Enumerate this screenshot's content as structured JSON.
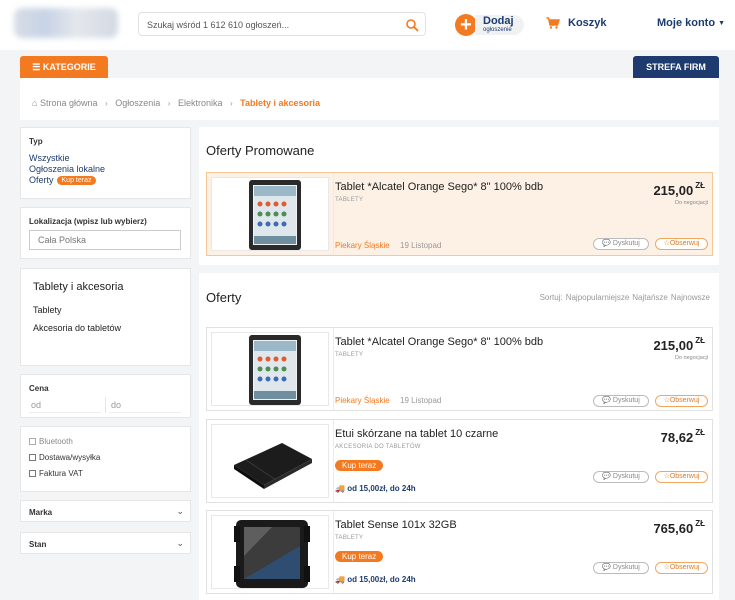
{
  "header": {
    "search_placeholder": "Szukaj wśród 1 612 610 ogłoszeń...",
    "add_main": "Dodaj",
    "add_sub": "ogłoszenie",
    "cart": "Koszyk",
    "account": "Moje konto"
  },
  "tabs": {
    "kategorie": "KATEGORIE",
    "strefa": "STREFA FIRM"
  },
  "breadcrumb": [
    "Strona główna",
    "Ogłoszenia",
    "Elektronika",
    "Tablety i akcesoria"
  ],
  "sidebar": {
    "typ_title": "Typ",
    "typ_links": [
      "Wszystkie",
      "Ogłoszenia lokalne",
      "Oferty"
    ],
    "buy_badge": "Kup teraz",
    "location_label": "Lokalizacja (wpisz lub wybierz)",
    "location_placeholder": "Cała Polska",
    "category_title": "Tablety i akcesoria",
    "category_items": [
      "Tablety",
      "Akcesoria do tabletów"
    ],
    "price_label": "Cena",
    "price_from": "od",
    "price_to": "do",
    "checkboxes": [
      "Bluetooth",
      "Dostawa/wysyłka",
      "Faktura VAT"
    ],
    "dropdowns": [
      "Marka",
      "Stan"
    ]
  },
  "promoted": {
    "title": "Oferty Promowane",
    "listing": {
      "title": "Tablet *Alcatel Orange Sego* 8\" 100% bdb",
      "category": "TABLETY",
      "price": "215,00",
      "currency": "ZŁ",
      "negotiable": "Do negocjacji",
      "location": "Piekary Śląskie",
      "date": "19 Listopad"
    }
  },
  "offers": {
    "title": "Oferty",
    "sort_label": "Sortuj:",
    "sort_options": [
      "Najpopularniejsze",
      "Najtańsze",
      "Najnowsze"
    ],
    "listings": [
      {
        "title": "Tablet *Alcatel Orange Sego* 8\" 100% bdb",
        "category": "TABLETY",
        "price": "215,00",
        "currency": "ZŁ",
        "negotiable": "Do negocjacji",
        "location": "Piekary Śląskie",
        "date": "19 Listopad"
      },
      {
        "title": "Etui skórzane na tablet 10 czarne",
        "category": "AKCESORIA DO TABLETÓW",
        "price": "78,62",
        "currency": "ZŁ",
        "badge": "Kup teraz",
        "shipping": "od 15,00zł, do 24h"
      },
      {
        "title": "Tablet Sense 101x 32GB",
        "category": "TABLETY",
        "price": "765,60",
        "currency": "ZŁ",
        "badge": "Kup teraz",
        "shipping": "od 15,00zł, do 24h"
      }
    ]
  },
  "buttons": {
    "discuss": "Dyskutuj",
    "watch": "Obserwuj"
  },
  "colors": {
    "accent": "#f47a21",
    "navy": "#1d3b6e",
    "promo_bg": "#fdf1e6"
  }
}
